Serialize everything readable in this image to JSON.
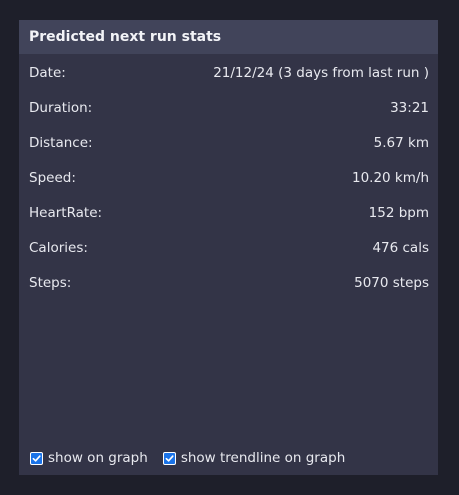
{
  "panel": {
    "title": "Predicted next run stats"
  },
  "stats": [
    {
      "label": "Date:",
      "value": "21/12/24 (3 days from last run )"
    },
    {
      "label": "Duration:",
      "value": "33:21"
    },
    {
      "label": "Distance:",
      "value": "5.67 km"
    },
    {
      "label": "Speed:",
      "value": "10.20 km/h"
    },
    {
      "label": "HeartRate:",
      "value": "152 bpm"
    },
    {
      "label": "Calories:",
      "value": "476 cals"
    },
    {
      "label": "Steps:",
      "value": "5070 steps"
    }
  ],
  "options": {
    "show_on_graph": {
      "label": "show on graph",
      "checked": true
    },
    "show_trendline": {
      "label": "show trendline on graph",
      "checked": true
    }
  },
  "colors": {
    "background": "#1e1f2a",
    "panel": "#333447",
    "header": "#41445a",
    "checkbox_accent": "#1a73e8"
  }
}
